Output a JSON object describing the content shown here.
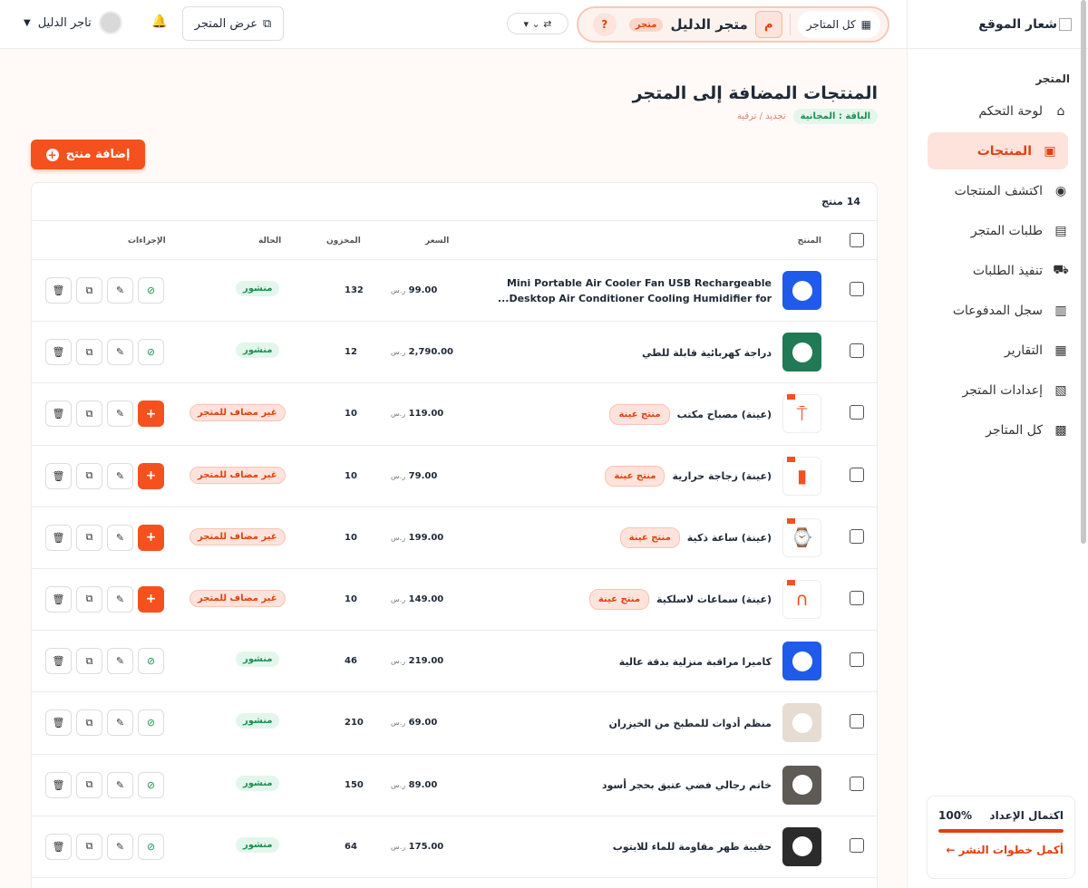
{
  "sidebar": {
    "logo_alt": "شعار الموقع",
    "section": "المتجر",
    "items": [
      {
        "label": "لوحة التحكم",
        "icon": "⌂"
      },
      {
        "label": "المنتجات",
        "icon": "▣"
      },
      {
        "label": "اكتشف المنتجات",
        "icon": "◉"
      },
      {
        "label": "طلبات المتجر",
        "icon": "▤"
      },
      {
        "label": "تنفيذ الطلبات",
        "icon": "⛟"
      },
      {
        "label": "سجل المدفوعات",
        "icon": "▥"
      },
      {
        "label": "التقارير",
        "icon": "▦"
      },
      {
        "label": "إعدادات المتجر",
        "icon": "▧"
      },
      {
        "label": "كل المتاجر",
        "icon": "▩"
      }
    ],
    "setup": {
      "label": "اكتمال الإعداد",
      "percent": "100%",
      "progress": 1.0,
      "link": "أكمل خطوات النشر ←"
    }
  },
  "topbar": {
    "all_stores": "كل المتاجر",
    "store_initial": "م",
    "store_name": "متجر الدليل",
    "store_tag": "متجر",
    "help": "?",
    "switcher": "⇄ ⌄ ▾",
    "view_store": "عرض المتجر",
    "bell": "🔔",
    "user_name": "تاجر الدليل",
    "caret": "▼"
  },
  "page": {
    "title": "المنتجات المضافة إلى المتجر",
    "plan": "الباقة : المجانية",
    "plan_link": "تجديد / ترقية",
    "add_button": "إضافة منتج",
    "count": "14 منتج"
  },
  "table": {
    "headers": {
      "product": "المنتج",
      "price": "السعر",
      "stock": "المخزون",
      "status": "الحالة",
      "actions": "الإجراءات"
    },
    "currency": "ر.س",
    "rows": [
      {
        "name": "Mini Portable Air Cooler Fan USB Rechargeable Desktop Air Conditioner Cooling Humidifier for...",
        "price": "99.00",
        "stock": "132",
        "status": "منشور",
        "published": true,
        "sample": false,
        "thumb": "#1f5bea"
      },
      {
        "name": "دراجة كهربائية قابلة للطي",
        "price": "2,790.00",
        "stock": "12",
        "status": "منشور",
        "published": true,
        "sample": false,
        "thumb": "#1f7a55"
      },
      {
        "name": "(عينة) مصباح مكتب",
        "price": "119.00",
        "stock": "10",
        "status": "غير مضاف للمتجر",
        "published": false,
        "sample": true,
        "badge": "منتج عينة",
        "glyph": "⍑"
      },
      {
        "name": "(عينة) زجاجة حرارية",
        "price": "79.00",
        "stock": "10",
        "status": "غير مضاف للمتجر",
        "published": false,
        "sample": true,
        "badge": "منتج عينة",
        "glyph": "▮"
      },
      {
        "name": "(عينة) ساعة ذكية",
        "price": "199.00",
        "stock": "10",
        "status": "غير مضاف للمتجر",
        "published": false,
        "sample": true,
        "badge": "منتج عينة",
        "glyph": "⌚"
      },
      {
        "name": "(عينة) سماعات لاسلكية",
        "price": "149.00",
        "stock": "10",
        "status": "غير مضاف للمتجر",
        "published": false,
        "sample": true,
        "badge": "منتج عينة",
        "glyph": "∩"
      },
      {
        "name": "كاميرا مراقبة منزلية بدقة عالية",
        "price": "219.00",
        "stock": "46",
        "status": "منشور",
        "published": true,
        "sample": false,
        "thumb": "#1f5bea"
      },
      {
        "name": "منظم أدوات للمطبخ من الخيزران",
        "price": "69.00",
        "stock": "210",
        "status": "منشور",
        "published": true,
        "sample": false,
        "thumb": "#e6dcd2"
      },
      {
        "name": "خاتم رجالي فضي عتيق بحجر أسود",
        "price": "89.00",
        "stock": "150",
        "status": "منشور",
        "published": true,
        "sample": false,
        "thumb": "#5e5a55"
      },
      {
        "name": "حقيبة ظهر مقاومة للماء للابتوب",
        "price": "175.00",
        "stock": "64",
        "status": "منشور",
        "published": true,
        "sample": false,
        "thumb": "#2b2b2b"
      }
    ]
  },
  "colors": {
    "accent": "#f4511e",
    "published": "#1a8f52",
    "sidebar_active_bg": "#fde3dc"
  }
}
